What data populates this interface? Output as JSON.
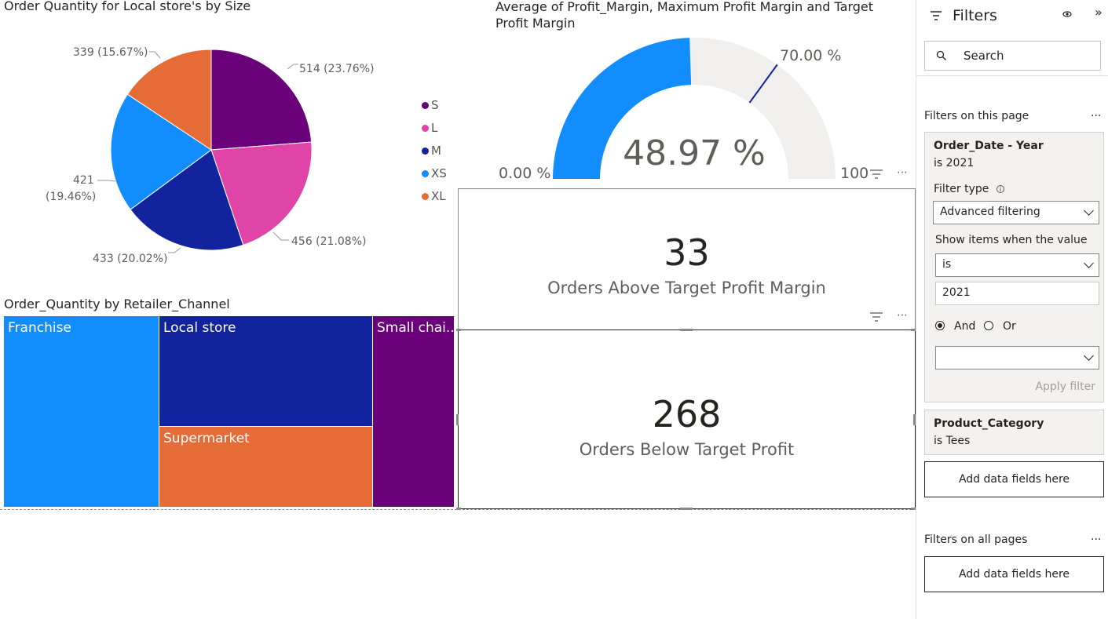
{
  "pie": {
    "title": "Order Quantity for Local store's by Size",
    "slices": [
      {
        "label": "514 (23.76%)",
        "value": 514,
        "color": "#6b007b"
      },
      {
        "label": "456 (21.08%)",
        "value": 456,
        "color": "#e044a7"
      },
      {
        "label": "433 (20.02%)",
        "value": 433,
        "color": "#12239e"
      },
      {
        "label_line1": "421",
        "label_line2": "(19.46%)",
        "value": 421,
        "color": "#118dff"
      },
      {
        "label": "339 (15.67%)",
        "value": 339,
        "color": "#e66c37"
      }
    ],
    "legend": [
      {
        "name": "S",
        "color": "#6b007b"
      },
      {
        "name": "L",
        "color": "#e044a7"
      },
      {
        "name": "M",
        "color": "#12239e"
      },
      {
        "name": "XS",
        "color": "#118dff"
      },
      {
        "name": "XL",
        "color": "#e66c37"
      }
    ]
  },
  "gauge": {
    "title_line1": "Average of Profit_Margin, Maximum Profit Margin and Target",
    "title_line2": "Profit Margin",
    "value_label": "48.97 %",
    "min_label": "0.00 %",
    "max_label": "100",
    "target_label": "70.00 %",
    "value": 48.97,
    "target": 70,
    "min": 0,
    "max": 100,
    "fill_color": "#118dff",
    "track_color": "#f0efee",
    "target_color": "#12239e"
  },
  "card_above": {
    "value": "33",
    "caption": "Orders Above Target Profit Margin"
  },
  "card_below": {
    "value": "268",
    "caption": "Orders Below Target Profit"
  },
  "treemap": {
    "title": "Order_Quantity by Retailer_Channel",
    "tiles": [
      {
        "label": "Franchise",
        "color": "#118dff"
      },
      {
        "label": "Local store",
        "color": "#12239e"
      },
      {
        "label": "Supermarket",
        "color": "#e66c37"
      },
      {
        "label": "Small chai...",
        "color": "#6b007b"
      }
    ]
  },
  "filters": {
    "title": "Filters",
    "search_placeholder": "Search",
    "on_this_page": "Filters on this page",
    "more": "...",
    "order_date": {
      "name": "Order_Date - Year",
      "summary": "is 2021",
      "filter_type_label": "Filter type",
      "filter_type_value": "Advanced filtering",
      "show_items_label": "Show items when the value",
      "operator": "is",
      "value": "2021",
      "and_label": "And",
      "or_label": "Or",
      "apply_label": "Apply filter"
    },
    "product_category": {
      "name": "Product_Category",
      "summary": "is Tees"
    },
    "add_fields": "Add data fields here",
    "on_all_pages": "Filters on all pages"
  }
}
